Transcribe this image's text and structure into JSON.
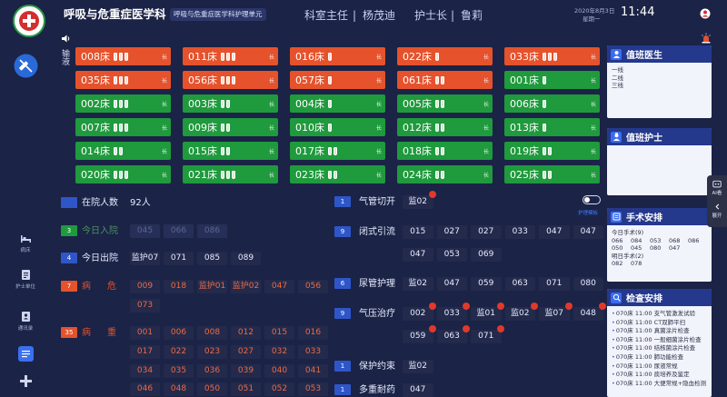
{
  "header": {
    "title": "呼吸与危重症医学科",
    "unit_badge": "呼吸与危重症医学科护理单元",
    "director_label": "科室主任",
    "director_name": "杨茂迪",
    "head_nurse_label": "护士长",
    "head_nurse_name": "鲁莉",
    "divider": "|",
    "date": "2020年8月3日",
    "weekday": "星期一",
    "time": "11:44"
  },
  "sidebar": {
    "top_icon": "syringe-off-icon",
    "items": [
      {
        "label": "病床",
        "icon": "bed-icon"
      },
      {
        "label": "护士单位",
        "icon": "nurse-unit-icon"
      },
      {
        "label": "通讯录",
        "icon": "contacts-icon"
      }
    ],
    "extra_icons": [
      "chat-icon",
      "add-icon"
    ]
  },
  "bed_grid": {
    "row_label": "输液",
    "tag": "长",
    "beds": [
      {
        "label": "008床",
        "status": "warning",
        "infusions": 3
      },
      {
        "label": "011床",
        "status": "warning",
        "infusions": 3
      },
      {
        "label": "016床",
        "status": "warning",
        "infusions": 1
      },
      {
        "label": "022床",
        "status": "warning",
        "infusions": 1
      },
      {
        "label": "033床",
        "status": "warning",
        "infusions": 3
      },
      {
        "label": "035床",
        "status": "warning",
        "infusions": 3
      },
      {
        "label": "056床",
        "status": "warning",
        "infusions": 3
      },
      {
        "label": "057床",
        "status": "warning",
        "infusions": 1
      },
      {
        "label": "061床",
        "status": "warning",
        "infusions": 2
      },
      {
        "label": "001床",
        "status": "normal",
        "infusions": 1
      },
      {
        "label": "002床",
        "status": "normal",
        "infusions": 3
      },
      {
        "label": "003床",
        "status": "normal",
        "infusions": 2
      },
      {
        "label": "004床",
        "status": "normal",
        "infusions": 1
      },
      {
        "label": "005床",
        "status": "normal",
        "infusions": 2
      },
      {
        "label": "006床",
        "status": "normal",
        "infusions": 1
      },
      {
        "label": "007床",
        "status": "normal",
        "infusions": 3
      },
      {
        "label": "009床",
        "status": "normal",
        "infusions": 2
      },
      {
        "label": "010床",
        "status": "normal",
        "infusions": 1
      },
      {
        "label": "012床",
        "status": "normal",
        "infusions": 2
      },
      {
        "label": "013床",
        "status": "normal",
        "infusions": 1
      },
      {
        "label": "014床",
        "status": "normal",
        "infusions": 2
      },
      {
        "label": "015床",
        "status": "normal",
        "infusions": 2
      },
      {
        "label": "017床",
        "status": "normal",
        "infusions": 2
      },
      {
        "label": "018床",
        "status": "normal",
        "infusions": 2
      },
      {
        "label": "019床",
        "status": "normal",
        "infusions": 2
      },
      {
        "label": "020床",
        "status": "normal",
        "infusions": 3
      },
      {
        "label": "021床",
        "status": "normal",
        "infusions": 3
      },
      {
        "label": "023床",
        "status": "normal",
        "infusions": 2
      },
      {
        "label": "024床",
        "status": "normal",
        "infusions": 2
      },
      {
        "label": "025床",
        "status": "normal",
        "infusions": 2
      }
    ]
  },
  "stats": {
    "in_hospital": {
      "label": "在院人数",
      "value": "92人"
    },
    "admitted": {
      "label": "今日入院",
      "count": "3",
      "beds": [
        "045",
        "066",
        "086"
      ]
    },
    "discharged": {
      "label": "今日出院",
      "count": "4",
      "beds": [
        "监护07",
        "071",
        "085",
        "089"
      ]
    },
    "critical": {
      "label": "病危",
      "count": "7",
      "beds": [
        "009",
        "018",
        "监护01",
        "监护02",
        "047",
        "056",
        "073"
      ]
    },
    "serious": {
      "label": "病重",
      "count": "35",
      "beds": [
        "001",
        "006",
        "008",
        "012",
        "015",
        "016",
        "017",
        "022",
        "023",
        "027",
        "032",
        "033",
        "034",
        "035",
        "036",
        "039",
        "040",
        "041",
        "046",
        "048",
        "050",
        "051",
        "052",
        "053"
      ]
    }
  },
  "care": {
    "tracheotomy": {
      "label": "气管切开",
      "count": "1",
      "beds": [
        {
          "code": "监02",
          "alert": true
        }
      ]
    },
    "closed_drainage": {
      "label": "闭式引流",
      "count": "9",
      "beds": [
        "015",
        "027",
        "027",
        "033",
        "047",
        "047",
        "047",
        "053",
        "069"
      ]
    },
    "catheter_care": {
      "label": "尿管护理",
      "count": "6",
      "beds": [
        "监02",
        "047",
        "059",
        "063",
        "071",
        "080"
      ]
    },
    "pneumatic_therapy": {
      "label": "气压治疗",
      "count": "9",
      "beds": [
        {
          "code": "002",
          "alert": true
        },
        {
          "code": "033",
          "alert": true
        },
        {
          "code": "监01",
          "alert": true
        },
        {
          "code": "监02",
          "alert": true
        },
        {
          "code": "监07",
          "alert": true
        },
        {
          "code": "048",
          "alert": true
        },
        {
          "code": "059",
          "alert": true
        },
        {
          "code": "063",
          "alert": true
        },
        {
          "code": "071",
          "alert": true
        }
      ]
    },
    "restraint": {
      "label": "保护约束",
      "count": "1",
      "beds": [
        "监02"
      ]
    },
    "mdr": {
      "label": "多重耐药",
      "count": "1",
      "beds": [
        "047"
      ]
    },
    "template_toggle": {
      "label": "护理模板",
      "on": false
    }
  },
  "panels": {
    "doctor": {
      "title": "值班医生",
      "lines": [
        "一线",
        "二线",
        "三线"
      ]
    },
    "nurse": {
      "title": "值班护士"
    },
    "surgery": {
      "title": "手术安排",
      "today_label": "今日手术(9)",
      "today": [
        "066",
        "084",
        "053",
        "068",
        "086",
        "050",
        "045",
        "080",
        "047"
      ],
      "tomorrow_label": "明日手术(2)",
      "tomorrow": [
        "082",
        "078"
      ]
    },
    "exam": {
      "title": "检查安排",
      "items": [
        {
          "bed": "070床",
          "time": "11:00",
          "item": "支气管激发试验"
        },
        {
          "bed": "070床",
          "time": "11:00",
          "item": "CT双肺平扫"
        },
        {
          "bed": "070床",
          "time": "11:00",
          "item": "真菌涂片检查"
        },
        {
          "bed": "070床",
          "time": "11:00",
          "item": "一般细菌涂片检查"
        },
        {
          "bed": "070床",
          "time": "11:00",
          "item": "结核菌涂片检查"
        },
        {
          "bed": "070床",
          "time": "11:00",
          "item": "肺功能检查"
        },
        {
          "bed": "070床",
          "time": "11:00",
          "item": "尿液常规"
        },
        {
          "bed": "070床",
          "time": "11:00",
          "item": "痰培养及鉴定"
        },
        {
          "bed": "070床",
          "time": "11:00",
          "item": "大便常规+隐血检测"
        }
      ]
    }
  },
  "tool_strip": {
    "ai_label": "AI看",
    "expand_label": "展开"
  },
  "colors": {
    "bg": "#1b2346",
    "orange": "#e5522c",
    "green": "#1f9a3d",
    "blue": "#2f56c9",
    "panel_header": "#24388c"
  }
}
